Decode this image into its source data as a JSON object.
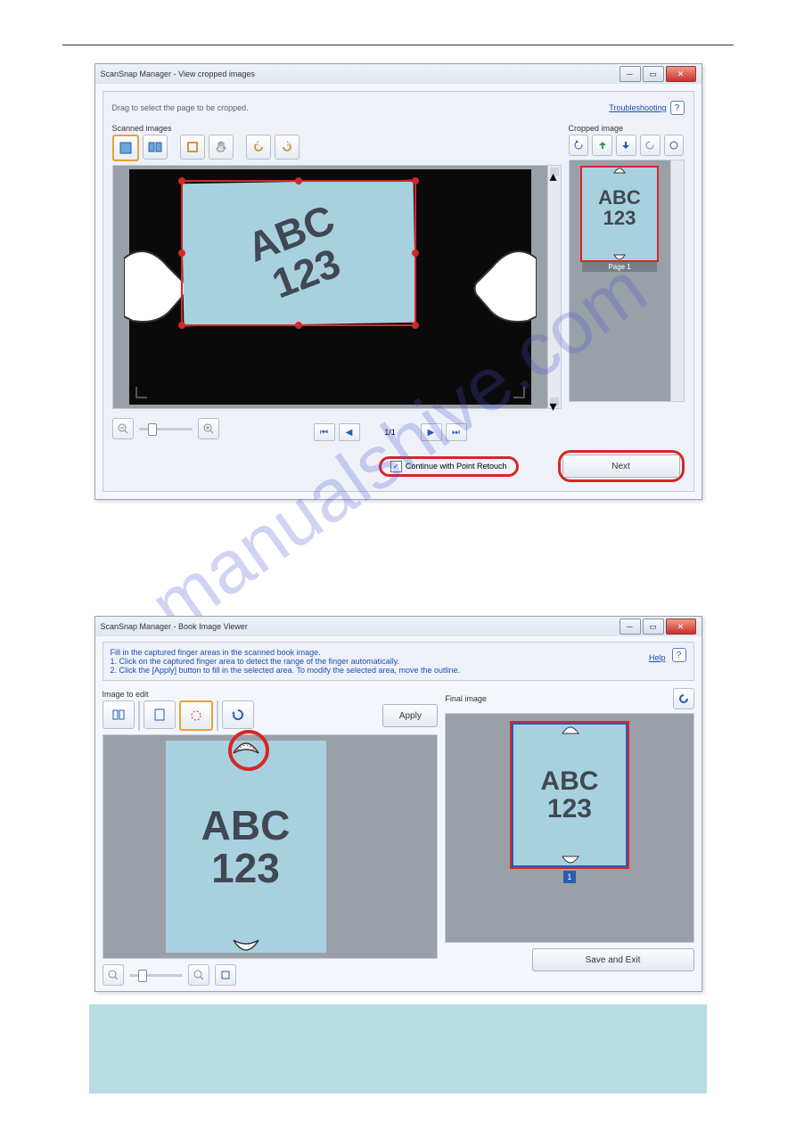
{
  "watermark": "manualshive.com",
  "doc_sample": {
    "line1": "ABC",
    "line2": "123"
  },
  "win1": {
    "title": "ScanSnap Manager - View cropped images",
    "instruction": "Drag to select the page to be cropped.",
    "troubleshoot": "Troubleshooting",
    "scanned_label": "Scanned images",
    "cropped_label": "Cropped image",
    "page_indicator": "1/1",
    "thumb_caption": "Page 1",
    "continue_label": "Continue with Point Retouch",
    "next_label": "Next"
  },
  "win2": {
    "title": "ScanSnap Manager - Book Image Viewer",
    "instr_title": "Fill in the captured finger areas in the scanned book image.",
    "instr_step1": "1. Click on the captured finger area to detect the range of the finger automatically.",
    "instr_step2": "2. Click the [Apply] button to fill in the selected area. To modify the selected area, move the outline.",
    "help": "Help",
    "edit_label": "Image to edit",
    "final_label": "Final image",
    "apply_label": "Apply",
    "thumb_num": "1",
    "save_label": "Save and Exit"
  }
}
